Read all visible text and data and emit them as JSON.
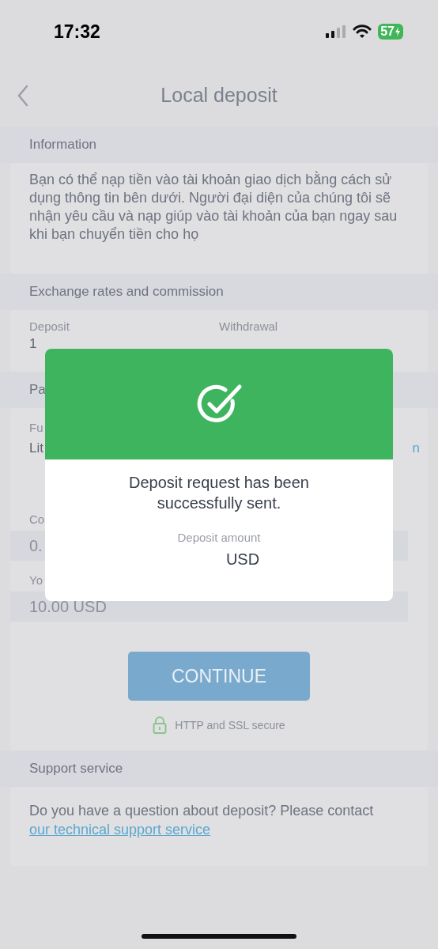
{
  "status_bar": {
    "time": "17:32",
    "battery": "57"
  },
  "nav": {
    "title": "Local deposit"
  },
  "sections": [
    {
      "kind": "text",
      "header": "Information",
      "text": "Bạn có thể nạp tiền vào tài khoản giao dịch bằng cách sử dụng thông tin bên dưới. Người đại diện của chúng tôi sẽ nhận yêu cầu và nạp giúp vào tài khoản của bạn ngay sau khi bạn chuyển tiền cho họ"
    },
    {
      "kind": "rates",
      "header": "Exchange rates and commission",
      "items": [
        {
          "label": "Deposit",
          "value": "1"
        },
        {
          "label": "Withdrawal"
        }
      ]
    },
    {
      "kind": "form",
      "header": "Pa",
      "fields": [
        {
          "kind": "info",
          "label": "Fu",
          "value": "Lit",
          "link": "n"
        },
        {
          "kind": "input",
          "label": "Co",
          "value": "0."
        },
        {
          "kind": "input",
          "label": "Yo",
          "value": "10.00 USD"
        }
      ],
      "button": {
        "label": "CONTINUE",
        "disabled": true
      },
      "secure": "HTTP and SSL secure"
    },
    {
      "kind": "support",
      "header": "Support service",
      "text": "Do you have a question about deposit? Please contact",
      "link": "our technical support service"
    }
  ],
  "modal": {
    "message": "Deposit request has been successfully sent.",
    "amount_label": "Deposit amount",
    "amount": "USD"
  }
}
